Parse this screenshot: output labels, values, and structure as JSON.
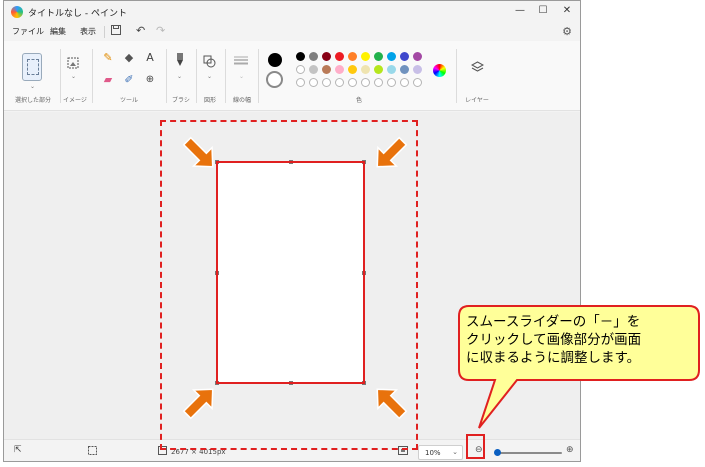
{
  "window": {
    "title": "タイトルなし - ペイント",
    "controls": {
      "minimize": "—",
      "maximize": "☐",
      "close": "✕"
    }
  },
  "menu": {
    "file": "ファイル",
    "edit": "編集",
    "view": "表示"
  },
  "ribbon": {
    "groups": {
      "selection": "選択した部分",
      "image": "イメージ",
      "tools": "ツール",
      "brushes": "ブラシ",
      "shapes": "図形",
      "size": "線の幅",
      "colors": "色",
      "layers": "レイヤー"
    },
    "icons": {
      "text_tool": "A",
      "magnifier": "⊕"
    },
    "palette_row1": [
      "#000000",
      "#7f7f7f",
      "#880015",
      "#ed1c24",
      "#ff7f27",
      "#fff200",
      "#22b14c",
      "#00a2e8",
      "#3f48cc",
      "#a349a4"
    ],
    "palette_row2": [
      "#ffffff",
      "#c3c3c3",
      "#b97a57",
      "#ffaec9",
      "#ffc90e",
      "#efe4b0",
      "#b5e61d",
      "#99d9ea",
      "#7092be",
      "#c8bfe7"
    ],
    "primary_color": "#000000",
    "secondary_color": "#ffffff"
  },
  "status": {
    "image_size": "2677 × 4015px",
    "zoom": "10%"
  },
  "annotation": {
    "callout_lines": [
      "スムースライダーの「－」を",
      "クリックして画像部分が画面",
      "に収まるように調整します。"
    ],
    "accent_red": "#e02020",
    "arrow_orange": "#e8720c",
    "callout_fill": "#ffff99"
  }
}
